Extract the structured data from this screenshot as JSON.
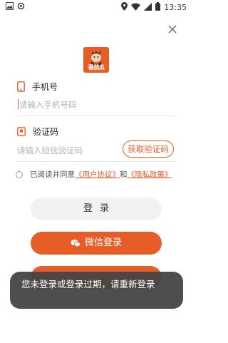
{
  "status_bar": {
    "time": "13:35",
    "icons": [
      "image-icon",
      "settings-icon",
      "location-icon",
      "wifi-icon",
      "signal-icon",
      "battery-icon"
    ]
  },
  "logo": {
    "text": "番茄瓜",
    "color": "#e65d27"
  },
  "phone_field": {
    "label": "手机号",
    "placeholder": "请输入手机号码",
    "icon": "phone-icon"
  },
  "code_field": {
    "label": "验证码",
    "placeholder": "请输入短信验证码",
    "icon": "sms-code-icon",
    "get_code_label": "获取验证码"
  },
  "agreement": {
    "prefix": "已阅读并同意",
    "user_agreement": "《用户协议》",
    "and": "和",
    "privacy_policy": "《隐私政策》"
  },
  "buttons": {
    "login": "登录",
    "wechat_login": "微信登录"
  },
  "toast": {
    "message": "您未登录或登录过期，请重新登录"
  },
  "colors": {
    "accent": "#e65d27",
    "login_button_bg": "#f2f2f2",
    "toast_bg": "#444444"
  }
}
